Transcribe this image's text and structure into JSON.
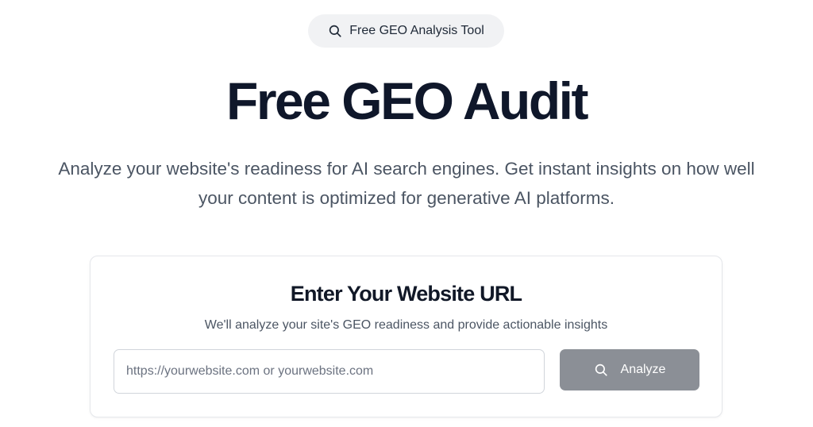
{
  "badge": {
    "icon": "search-icon",
    "label": "Free GEO Analysis Tool"
  },
  "hero": {
    "title": "Free GEO Audit",
    "description": "Analyze your website's readiness for AI search engines. Get instant insights on how well your content is optimized for generative AI platforms."
  },
  "card": {
    "title": "Enter Your Website URL",
    "subtitle": "We'll analyze your site's GEO readiness and provide actionable insights",
    "input": {
      "value": "",
      "placeholder": "https://yourwebsite.com or yourwebsite.com"
    },
    "button": {
      "icon": "search-icon",
      "label": "Analyze"
    }
  },
  "colors": {
    "title": "#0f172a",
    "text_muted": "#4b5563",
    "badge_bg": "#f1f2f4",
    "button_bg": "#8b8f96",
    "border": "#e5e7eb"
  }
}
